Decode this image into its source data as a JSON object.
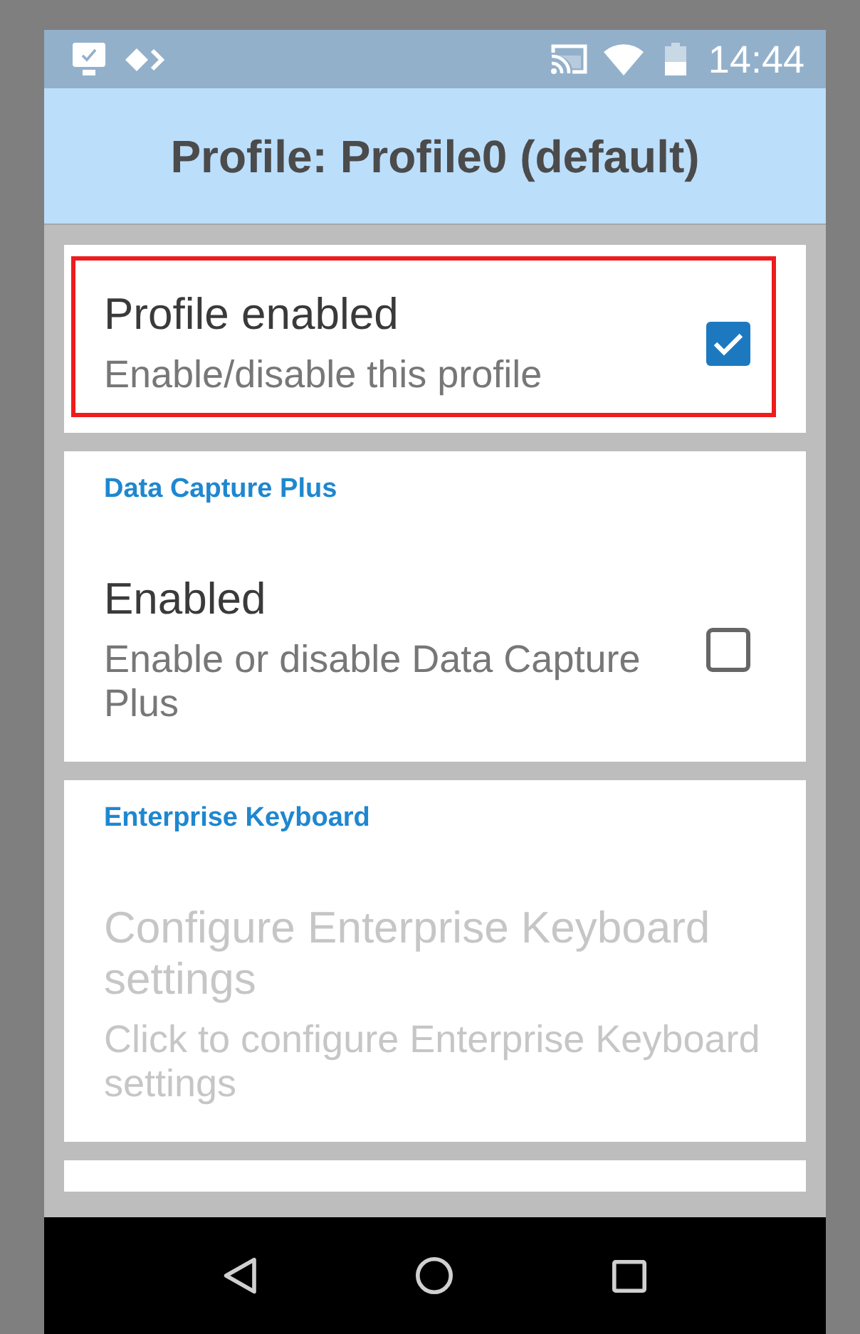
{
  "status_bar": {
    "time": "14:44"
  },
  "app_bar": {
    "title": "Profile: Profile0 (default)"
  },
  "cards": [
    {
      "items": [
        {
          "kind": "checkbox",
          "title": "Profile enabled",
          "summary": "Enable/disable this profile",
          "checked": true,
          "disabled": false,
          "highlighted": true
        }
      ]
    },
    {
      "category": "Data Capture Plus",
      "items": [
        {
          "kind": "checkbox",
          "title": "Enabled",
          "summary": "Enable or disable Data Capture Plus",
          "checked": false,
          "disabled": false,
          "highlighted": false
        }
      ]
    },
    {
      "category": "Enterprise Keyboard",
      "items": [
        {
          "kind": "link",
          "title": "Configure Enterprise Keyboard settings",
          "summary": "Click to configure Enterprise Keyboard settings",
          "disabled": true,
          "highlighted": false
        }
      ]
    }
  ]
}
